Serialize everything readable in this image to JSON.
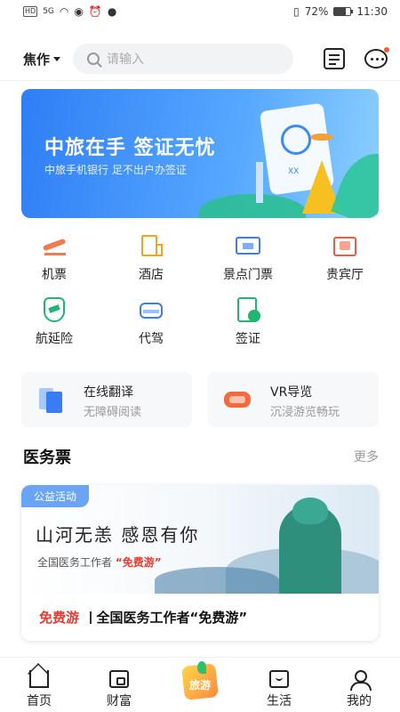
{
  "status_bar": {
    "network": "HD",
    "signal": "5G",
    "battery": "72%",
    "battery_level": 0.72,
    "time": "11:30"
  },
  "header": {
    "city": "焦作",
    "search_placeholder": "请输入"
  },
  "banner": {
    "title": "中旅在手 签证无忧",
    "subtitle": "中旅手机银行 足不出户办签证",
    "card_text": "XX"
  },
  "services": [
    {
      "label": "机票",
      "icon": "plane-icon"
    },
    {
      "label": "酒店",
      "icon": "hotel-icon"
    },
    {
      "label": "景点门票",
      "icon": "ticket-icon"
    },
    {
      "label": "贵宾厅",
      "icon": "vip-lounge-icon"
    },
    {
      "label": "航延险",
      "icon": "flight-delay-insurance-icon"
    },
    {
      "label": "代驾",
      "icon": "car-icon"
    },
    {
      "label": "签证",
      "icon": "visa-icon"
    }
  ],
  "features": [
    {
      "title": "在线翻译",
      "subtitle": "无障碍阅读",
      "icon": "translate-icon"
    },
    {
      "title": "VR导览",
      "subtitle": "沉浸游览畅玩",
      "icon": "vr-headset-icon"
    }
  ],
  "section": {
    "title": "医务票",
    "more": "更多"
  },
  "promo": {
    "badge": "公益活动",
    "poem": "山河无恙 感恩有你",
    "line2_prefix": "全国医务工作者",
    "line2_highlight": "“免费游”",
    "bottom_red": "免费游",
    "bottom_text": "全国医务工作者“免费游”"
  },
  "tabbar": [
    {
      "label": "首页",
      "icon": "home-icon"
    },
    {
      "label": "财富",
      "icon": "wallet-icon"
    },
    {
      "label": "旅游",
      "icon": "travel-icon"
    },
    {
      "label": "生活",
      "icon": "bag-icon"
    },
    {
      "label": "我的",
      "icon": "user-icon"
    }
  ],
  "colors": {
    "accent_blue": "#3a7cf3",
    "promo_red": "#e73b2f",
    "notification_dot": "#f25a3a"
  }
}
